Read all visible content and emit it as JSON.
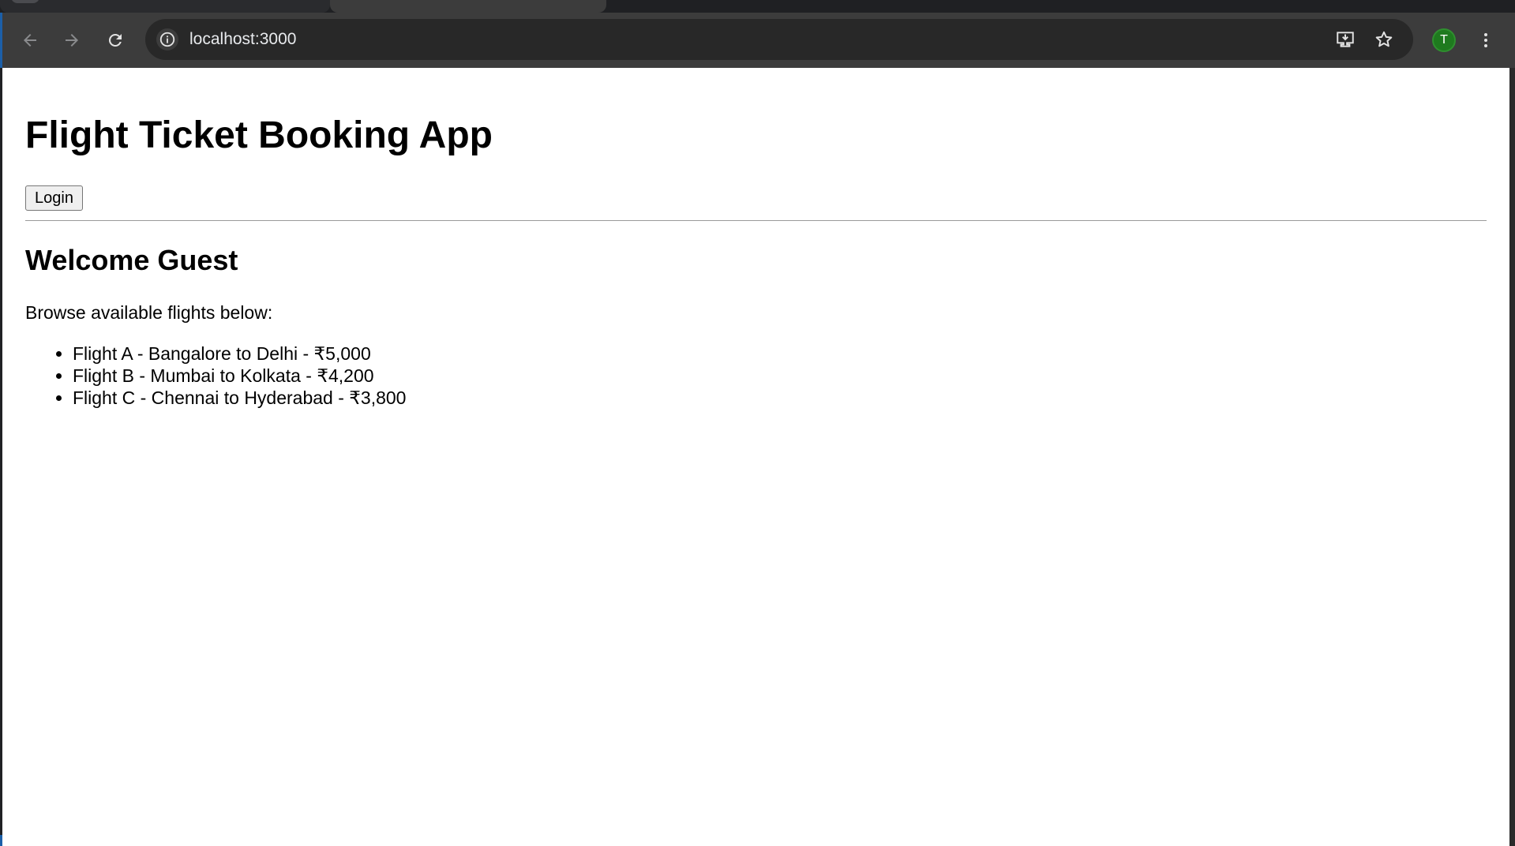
{
  "browser": {
    "url": "localhost:3000",
    "profile_initial": "T",
    "icons": {
      "back": "arrow-left-icon",
      "forward": "arrow-right-icon",
      "reload": "reload-icon",
      "site_info": "info-icon",
      "install": "install-app-icon",
      "bookmark": "star-icon",
      "menu": "kebab-menu-icon"
    },
    "colors": {
      "toolbar": "#3c3c3c",
      "omnibox": "#282828",
      "avatar": "#1e7a1e"
    }
  },
  "page": {
    "title": "Flight Ticket Booking App",
    "login_label": "Login",
    "welcome": "Welcome Guest",
    "intro": "Browse available flights below:",
    "flights": [
      "Flight A - Bangalore to Delhi - ₹5,000",
      "Flight B - Mumbai to Kolkata - ₹4,200",
      "Flight C - Chennai to Hyderabad - ₹3,800"
    ]
  }
}
